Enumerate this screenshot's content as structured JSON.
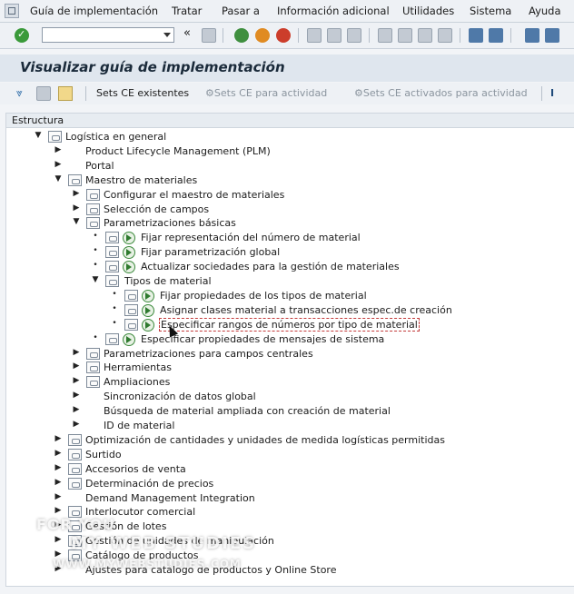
{
  "menubar": {
    "items": [
      "Guía de implementación",
      "Tratar",
      "Pasar a",
      "Información adicional",
      "Utilidades",
      "Sistema",
      "Ayuda"
    ]
  },
  "toolbar": {
    "command_value": ""
  },
  "title": "Visualizar guía de implementación",
  "app_toolbar": {
    "existing_ce": "Sets CE existentes",
    "ce_activity": "Sets CE para actividad",
    "ce_activated": "Sets CE activados para actividad",
    "info": "I"
  },
  "tree": {
    "header": "Estructura",
    "rows": [
      {
        "label": "Logística en general",
        "level": 0,
        "expander": "▼",
        "doc": true,
        "exec": false
      },
      {
        "label": "Product Lifecycle Management (PLM)",
        "level": 1,
        "expander": "▶",
        "doc": false,
        "exec": false
      },
      {
        "label": "Portal",
        "level": 1,
        "expander": "▶",
        "doc": false,
        "exec": false
      },
      {
        "label": "Maestro de materiales",
        "level": 1,
        "expander": "▼",
        "doc": true,
        "exec": false
      },
      {
        "label": "Configurar el maestro de materiales",
        "level": 2,
        "expander": "▶",
        "doc": true,
        "exec": false
      },
      {
        "label": "Selección de campos",
        "level": 2,
        "expander": "▶",
        "doc": true,
        "exec": false
      },
      {
        "label": "Parametrizaciones básicas",
        "level": 2,
        "expander": "▼",
        "doc": true,
        "exec": false
      },
      {
        "label": "Fijar representación del número de material",
        "level": 3,
        "expander": "•",
        "doc": true,
        "exec": true
      },
      {
        "label": "Fijar parametrización global",
        "level": 3,
        "expander": "•",
        "doc": true,
        "exec": true
      },
      {
        "label": "Actualizar sociedades para la gestión de materiales",
        "level": 3,
        "expander": "•",
        "doc": true,
        "exec": true
      },
      {
        "label": "Tipos de material",
        "level": 3,
        "expander": "▼",
        "doc": true,
        "exec": false
      },
      {
        "label": "Fijar propiedades de los tipos de material",
        "level": 4,
        "expander": "•",
        "doc": true,
        "exec": true
      },
      {
        "label": "Asignar clases material a transacciones espec.de creación",
        "level": 4,
        "expander": "•",
        "doc": true,
        "exec": true
      },
      {
        "label": "Especificar rangos de números por tipo de material",
        "level": 4,
        "expander": "•",
        "doc": true,
        "exec": true,
        "selected": true
      },
      {
        "label": "Especificar propiedades de mensajes de sistema",
        "level": 3,
        "expander": "•",
        "doc": true,
        "exec": true
      },
      {
        "label": "Parametrizaciones para campos centrales",
        "level": 2,
        "expander": "▶",
        "doc": true,
        "exec": false
      },
      {
        "label": "Herramientas",
        "level": 2,
        "expander": "▶",
        "doc": true,
        "exec": false
      },
      {
        "label": "Ampliaciones",
        "level": 2,
        "expander": "▶",
        "doc": true,
        "exec": false
      },
      {
        "label": "Sincronización de datos global",
        "level": 2,
        "expander": "▶",
        "doc": false,
        "exec": false
      },
      {
        "label": "Búsqueda de material ampliada con creación de material",
        "level": 2,
        "expander": "▶",
        "doc": false,
        "exec": false
      },
      {
        "label": "ID de material",
        "level": 2,
        "expander": "▶",
        "doc": false,
        "exec": false
      },
      {
        "label": "Optimización de cantidades y unidades de medida logísticas permitidas",
        "level": 1,
        "expander": "▶",
        "doc": true,
        "exec": false
      },
      {
        "label": "Surtido",
        "level": 1,
        "expander": "▶",
        "doc": true,
        "exec": false
      },
      {
        "label": "Accesorios de venta",
        "level": 1,
        "expander": "▶",
        "doc": true,
        "exec": false
      },
      {
        "label": "Determinación de precios",
        "level": 1,
        "expander": "▶",
        "doc": true,
        "exec": false
      },
      {
        "label": "Demand Management Integration",
        "level": 1,
        "expander": "▶",
        "doc": false,
        "exec": false
      },
      {
        "label": "Interlocutor comercial",
        "level": 1,
        "expander": "▶",
        "doc": true,
        "exec": false
      },
      {
        "label": "Gestión de lotes",
        "level": 1,
        "expander": "▶",
        "doc": true,
        "exec": false
      },
      {
        "label": "Gestión de unidades de manipulación",
        "level": 1,
        "expander": "▶",
        "doc": true,
        "exec": false
      },
      {
        "label": "Catálogo de productos",
        "level": 1,
        "expander": "▶",
        "doc": true,
        "exec": false
      },
      {
        "label": "Ajustes para catálogo de productos y Online Store",
        "level": 1,
        "expander": "▶",
        "doc": false,
        "exec": false
      }
    ]
  },
  "watermark": {
    "line1": "FOR YOU",
    "line2": "MY WEB STUDIES",
    "line3": "WWW.MYWEBSTUDIES.COM"
  }
}
